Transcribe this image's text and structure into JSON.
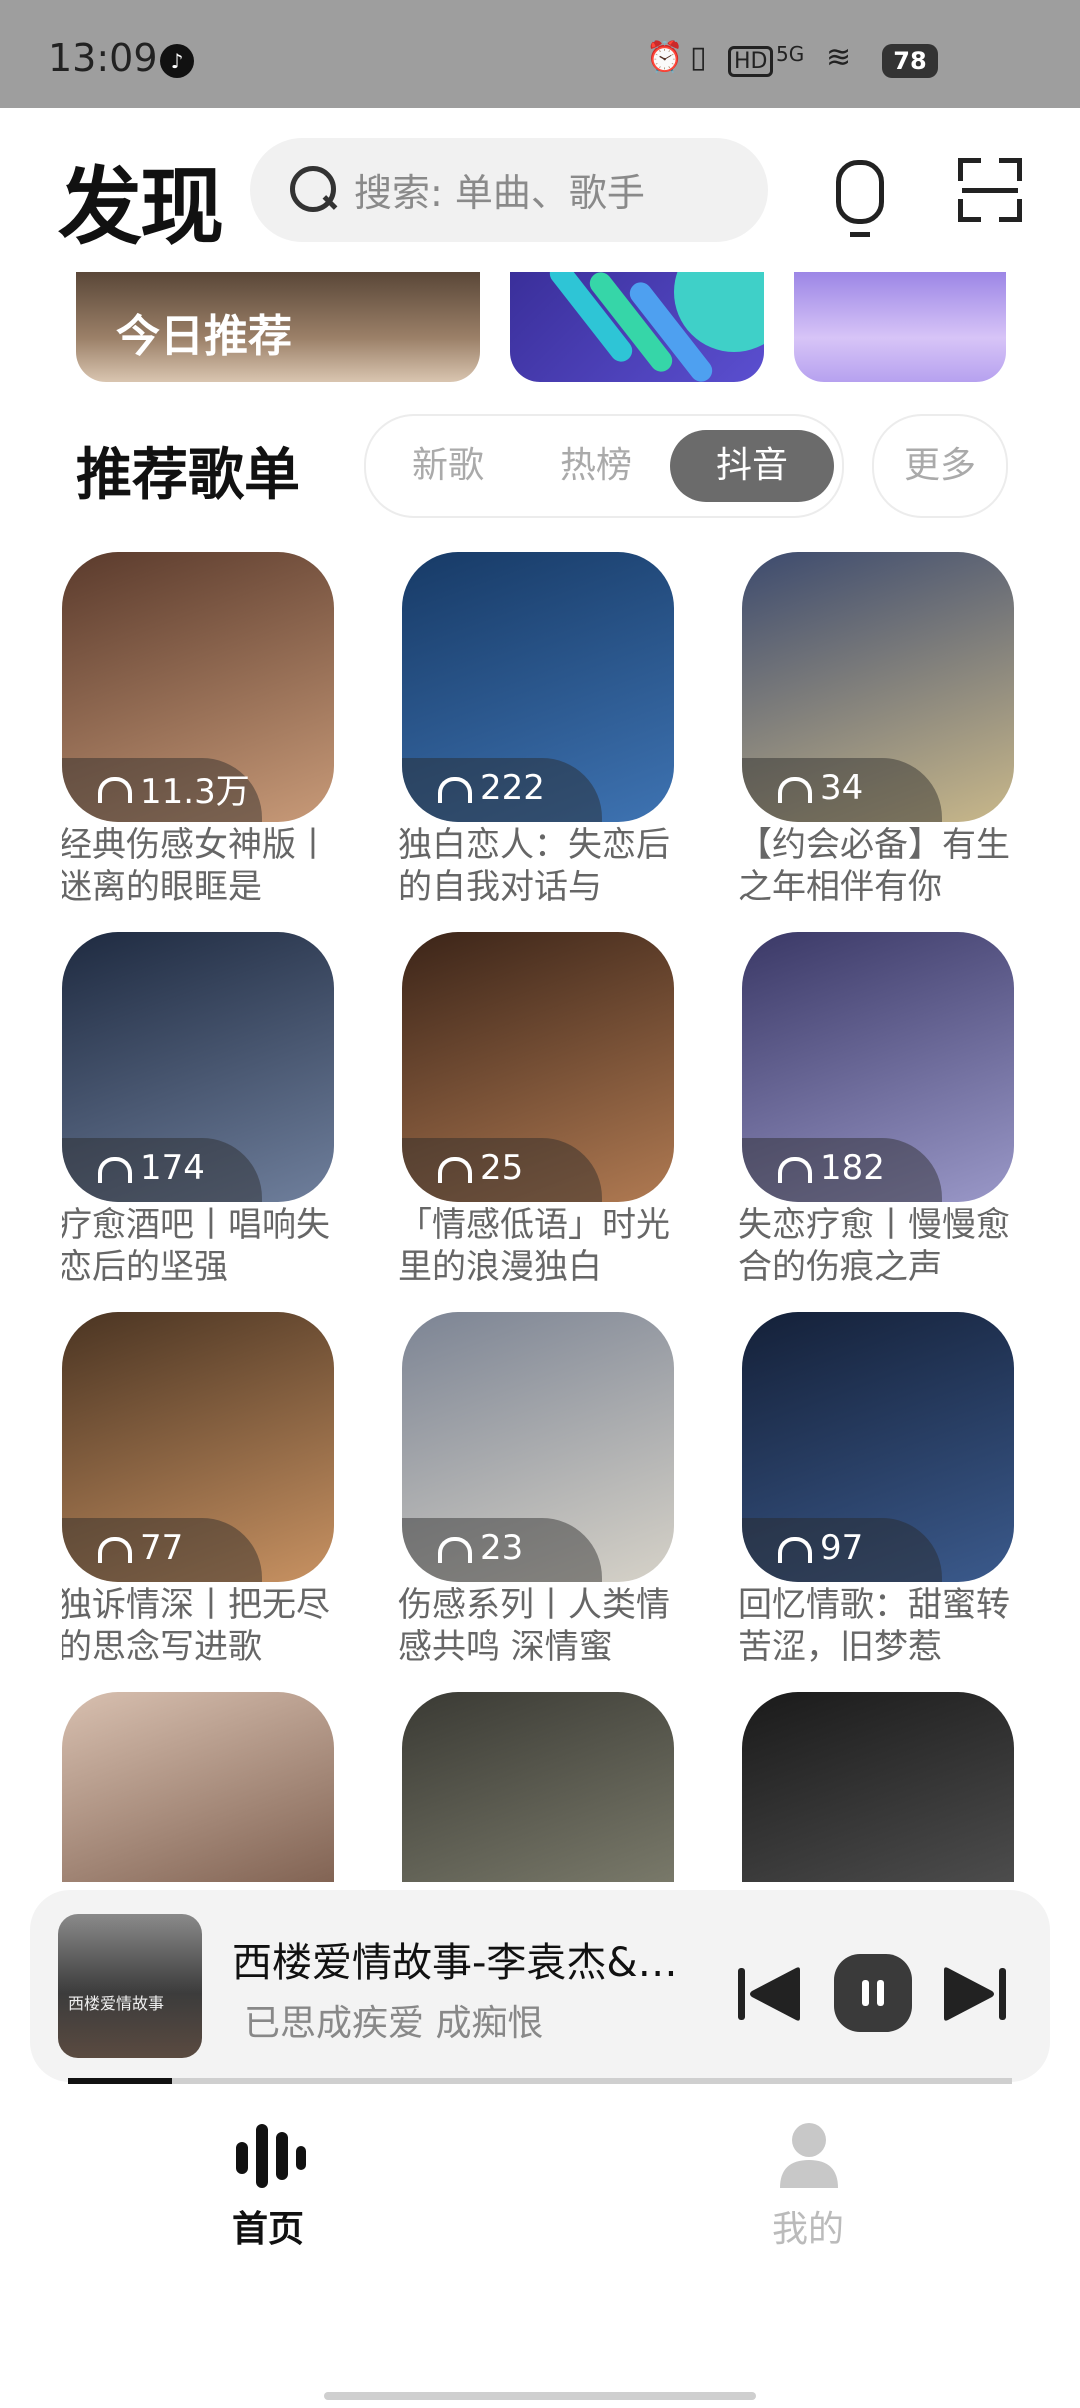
{
  "status_bar": {
    "time": "13:09",
    "battery": "78",
    "network": "5G"
  },
  "header": {
    "title": "发现",
    "search_placeholder": "搜索: 单曲、歌手"
  },
  "banner": {
    "today_label": "今日推荐"
  },
  "section": {
    "title": "推荐歌单",
    "tabs": [
      {
        "label": "新歌",
        "active": false
      },
      {
        "label": "热榜",
        "active": false
      },
      {
        "label": "抖音",
        "active": true
      }
    ],
    "more_label": "更多"
  },
  "playlists": [
    {
      "count": "11.3万",
      "title": "经典伤感女神版丨迷离的眼眶是",
      "colors": [
        "#5a3a2c",
        "#c89a78"
      ]
    },
    {
      "count": "222",
      "title": "独白恋人：失恋后的自我对话与",
      "colors": [
        "#173a66",
        "#3e73b2"
      ]
    },
    {
      "count": "34",
      "title": "【约会必备】有生之年相伴有你",
      "colors": [
        "#3c4a6e",
        "#c9b88a"
      ]
    },
    {
      "count": "174",
      "title": "疗愈酒吧丨唱响失恋后的坚强",
      "colors": [
        "#1e2a40",
        "#6f7f9c"
      ]
    },
    {
      "count": "25",
      "title": "「情感低语」时光里的浪漫独白",
      "colors": [
        "#3b2418",
        "#b07a52"
      ]
    },
    {
      "count": "182",
      "title": "失恋疗愈丨慢慢愈合的伤痕之声",
      "colors": [
        "#3a3866",
        "#9a98c8"
      ]
    },
    {
      "count": "77",
      "title": "独诉情深丨把无尽的思念写进歌",
      "colors": [
        "#4a3422",
        "#c89262"
      ]
    },
    {
      "count": "23",
      "title": "伤感系列丨人类情感共鸣 深情蜜",
      "colors": [
        "#7c8494",
        "#d6d2c8"
      ]
    },
    {
      "count": "97",
      "title": "回忆情歌：甜蜜转苦涩，旧梦惹",
      "colors": [
        "#142038",
        "#3b5a8c"
      ]
    },
    {
      "count": "",
      "title": "",
      "colors": [
        "#d8c0b0",
        "#6a4a3a"
      ]
    },
    {
      "count": "",
      "title": "",
      "colors": [
        "#3a3a34",
        "#8a8a78"
      ]
    },
    {
      "count": "",
      "title": "",
      "colors": [
        "#1a1a1a",
        "#5a5a5a"
      ]
    }
  ],
  "player": {
    "title": "西楼爱情故事-李袁杰&…",
    "lyric": "已思成疾爱 成痴恨",
    "cover_text": "西楼爱情故事",
    "progress": 0.11
  },
  "nav": {
    "home_label": "首页",
    "mine_label": "我的"
  }
}
